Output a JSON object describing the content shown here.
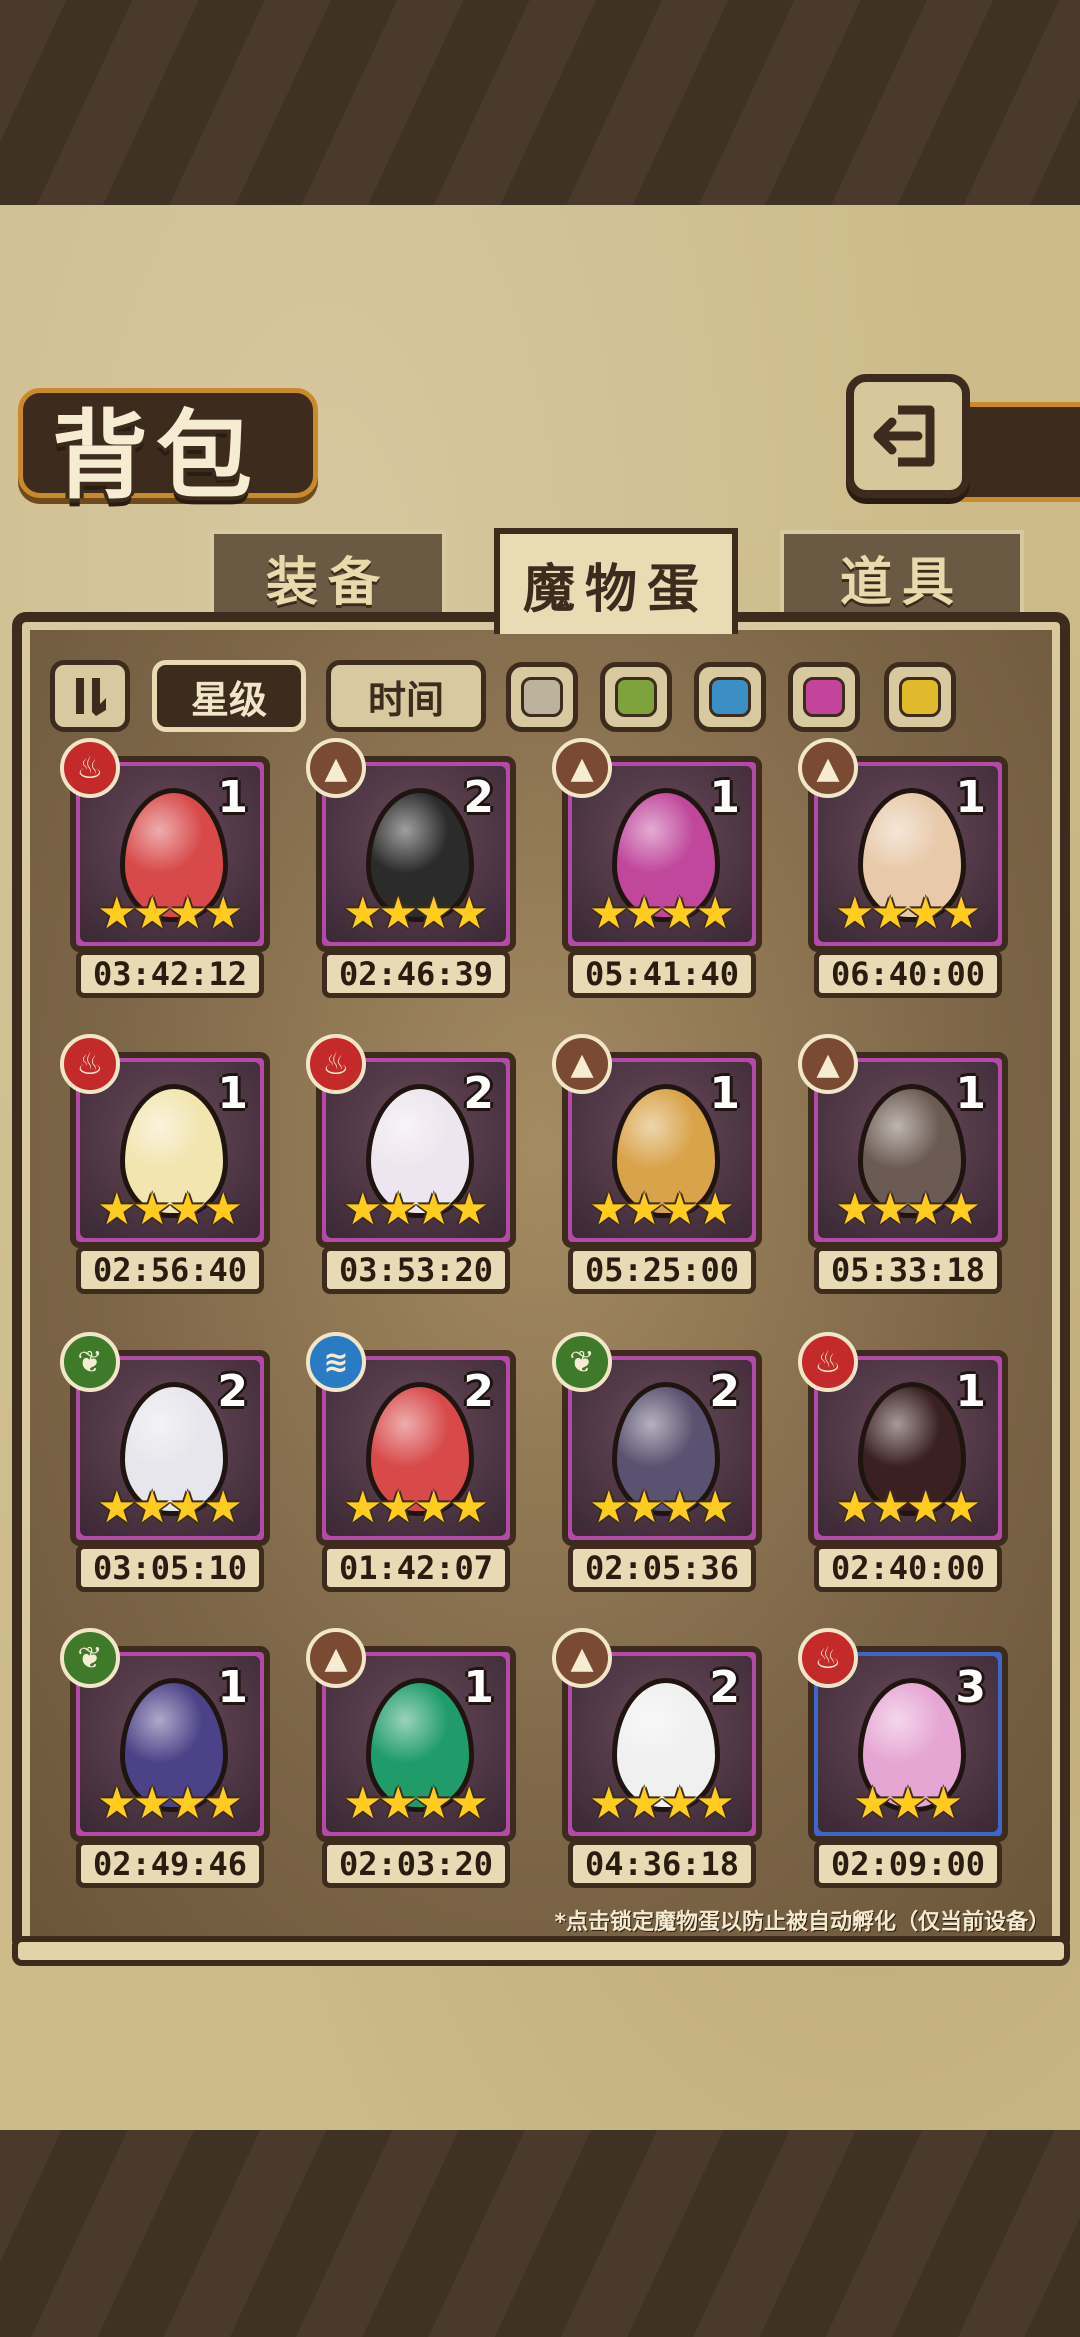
{
  "title": "背包",
  "tabs": [
    {
      "label": "装备",
      "active": false
    },
    {
      "label": "魔物蛋",
      "active": true
    },
    {
      "label": "道具",
      "active": false
    }
  ],
  "filters": {
    "sort_toggle_icon": "pause-bars-icon",
    "star_label": "星级",
    "time_label": "时间",
    "color_filters": [
      "#bcb39c",
      "#7fa33c",
      "#3c8fc4",
      "#c4449c",
      "#e0b92c"
    ]
  },
  "eggs": [
    {
      "element": "fire",
      "count": "1",
      "stars": 4,
      "timer": "03:42:12",
      "color": "#d84a4a",
      "frame": "purple"
    },
    {
      "element": "earth",
      "count": "2",
      "stars": 4,
      "timer": "02:46:39",
      "color": "#2b2b2b",
      "frame": "purple"
    },
    {
      "element": "earth",
      "count": "1",
      "stars": 4,
      "timer": "05:41:40",
      "color": "#c0479c",
      "frame": "purple"
    },
    {
      "element": "earth",
      "count": "1",
      "stars": 4,
      "timer": "06:40:00",
      "color": "#e8c9a9",
      "frame": "purple"
    },
    {
      "element": "fire",
      "count": "1",
      "stars": 4,
      "timer": "02:56:40",
      "color": "#f2e5b0",
      "frame": "purple"
    },
    {
      "element": "fire",
      "count": "2",
      "stars": 4,
      "timer": "03:53:20",
      "color": "#eee6ee",
      "frame": "purple"
    },
    {
      "element": "earth",
      "count": "1",
      "stars": 4,
      "timer": "05:25:00",
      "color": "#d9a34a",
      "frame": "purple"
    },
    {
      "element": "earth",
      "count": "1",
      "stars": 4,
      "timer": "05:33:18",
      "color": "#6c5b52",
      "frame": "purple"
    },
    {
      "element": "wood",
      "count": "2",
      "stars": 4,
      "timer": "03:05:10",
      "color": "#e6e6ec",
      "frame": "purple"
    },
    {
      "element": "water",
      "count": "2",
      "stars": 4,
      "timer": "01:42:07",
      "color": "#d84a4a",
      "frame": "purple"
    },
    {
      "element": "wood",
      "count": "2",
      "stars": 4,
      "timer": "02:05:36",
      "color": "#5a5270",
      "frame": "purple"
    },
    {
      "element": "fire",
      "count": "1",
      "stars": 4,
      "timer": "02:40:00",
      "color": "#3a2020",
      "frame": "purple"
    },
    {
      "element": "wood",
      "count": "1",
      "stars": 4,
      "timer": "02:49:46",
      "color": "#4c4288",
      "frame": "purple"
    },
    {
      "element": "earth",
      "count": "1",
      "stars": 4,
      "timer": "02:03:20",
      "color": "#1f9c6a",
      "frame": "purple"
    },
    {
      "element": "earth",
      "count": "2",
      "stars": 4,
      "timer": "04:36:18",
      "color": "#f0f0f0",
      "frame": "purple"
    },
    {
      "element": "fire",
      "count": "3",
      "stars": 3,
      "timer": "02:09:00",
      "color": "#e6a6d4",
      "frame": "blue"
    }
  ],
  "element_icons": {
    "fire": {
      "icon": "flame-icon",
      "bg": "#c42a2a",
      "glyph": "♨"
    },
    "earth": {
      "icon": "mountain-icon",
      "bg": "#7a4a32",
      "glyph": "▲"
    },
    "wood": {
      "icon": "leaf-icon",
      "bg": "#3e7a2a",
      "glyph": "❦"
    },
    "water": {
      "icon": "wave-icon",
      "bg": "#2a7ac4",
      "glyph": "≋"
    }
  },
  "frame_colors": {
    "purple": "#b34aa8",
    "blue": "#3f66c8"
  },
  "footnote": "*点击锁定魔物蛋以防止被自动孵化（仅当前设备）"
}
